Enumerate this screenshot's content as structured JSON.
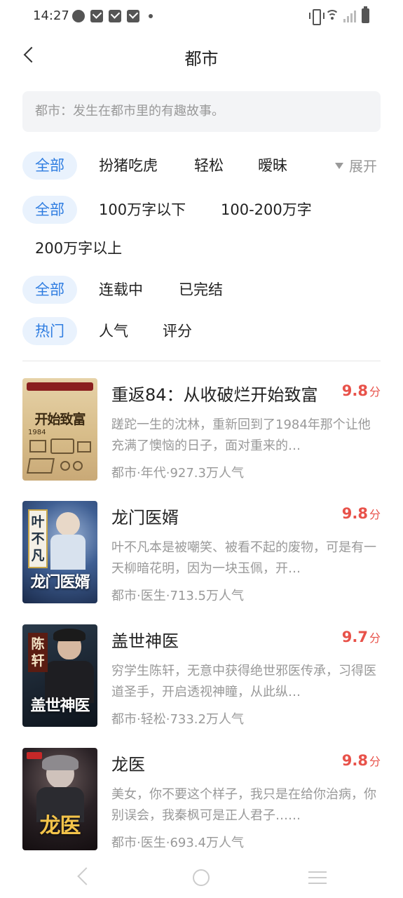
{
  "status_bar": {
    "time": "14:27"
  },
  "header": {
    "title": "都市"
  },
  "description": "都市：发生在都市里的有趣故事。",
  "filters": {
    "tags": {
      "active": "全部",
      "items": [
        "扮猪吃虎",
        "轻松",
        "暧昧"
      ],
      "expand_label": "展开"
    },
    "word_count": {
      "active": "全部",
      "items": [
        "100万字以下",
        "100-200万字",
        "200万字以上"
      ]
    },
    "status": {
      "active": "全部",
      "items": [
        "连载中",
        "已完结"
      ]
    },
    "sort": {
      "active": "热门",
      "items": [
        "人气",
        "评分"
      ]
    }
  },
  "books": [
    {
      "title": "重返84：从收破烂开始致富",
      "score": "9.8",
      "score_unit": "分",
      "desc": "蹉跎一生的沈林，重新回到了1984年那个让他充满了懊恼的日子，面对重来的…",
      "meta": "都市·年代·927.3万人气",
      "cover_text": "开始致富",
      "cover_year": "1984"
    },
    {
      "title": "龙门医婿",
      "score": "9.8",
      "score_unit": "分",
      "desc": "叶不凡本是被嘲笑、被看不起的废物，可是有一天柳暗花明，因为一块玉佩，开…",
      "meta": "都市·医生·713.5万人气",
      "cover_text": "龙门医婿",
      "cover_vert": "叶不凡"
    },
    {
      "title": "盖世神医",
      "score": "9.7",
      "score_unit": "分",
      "desc": "穷学生陈轩，无意中获得绝世邪医传承，习得医道圣手，开启透视神瞳，从此纵…",
      "meta": "都市·轻松·733.2万人气",
      "cover_text": "盖世神医",
      "cover_vert": "陈轩"
    },
    {
      "title": "龙医",
      "score": "9.8",
      "score_unit": "分",
      "desc": "美女，你不要这个样子，我只是在给你治病，你别误会，我秦枫可是正人君子……",
      "meta": "都市·医生·693.4万人气",
      "cover_text": "龙医"
    }
  ],
  "colors": {
    "accent": "#2f7de1",
    "chip_bg": "#e9f2fd",
    "score": "#e8524a"
  }
}
